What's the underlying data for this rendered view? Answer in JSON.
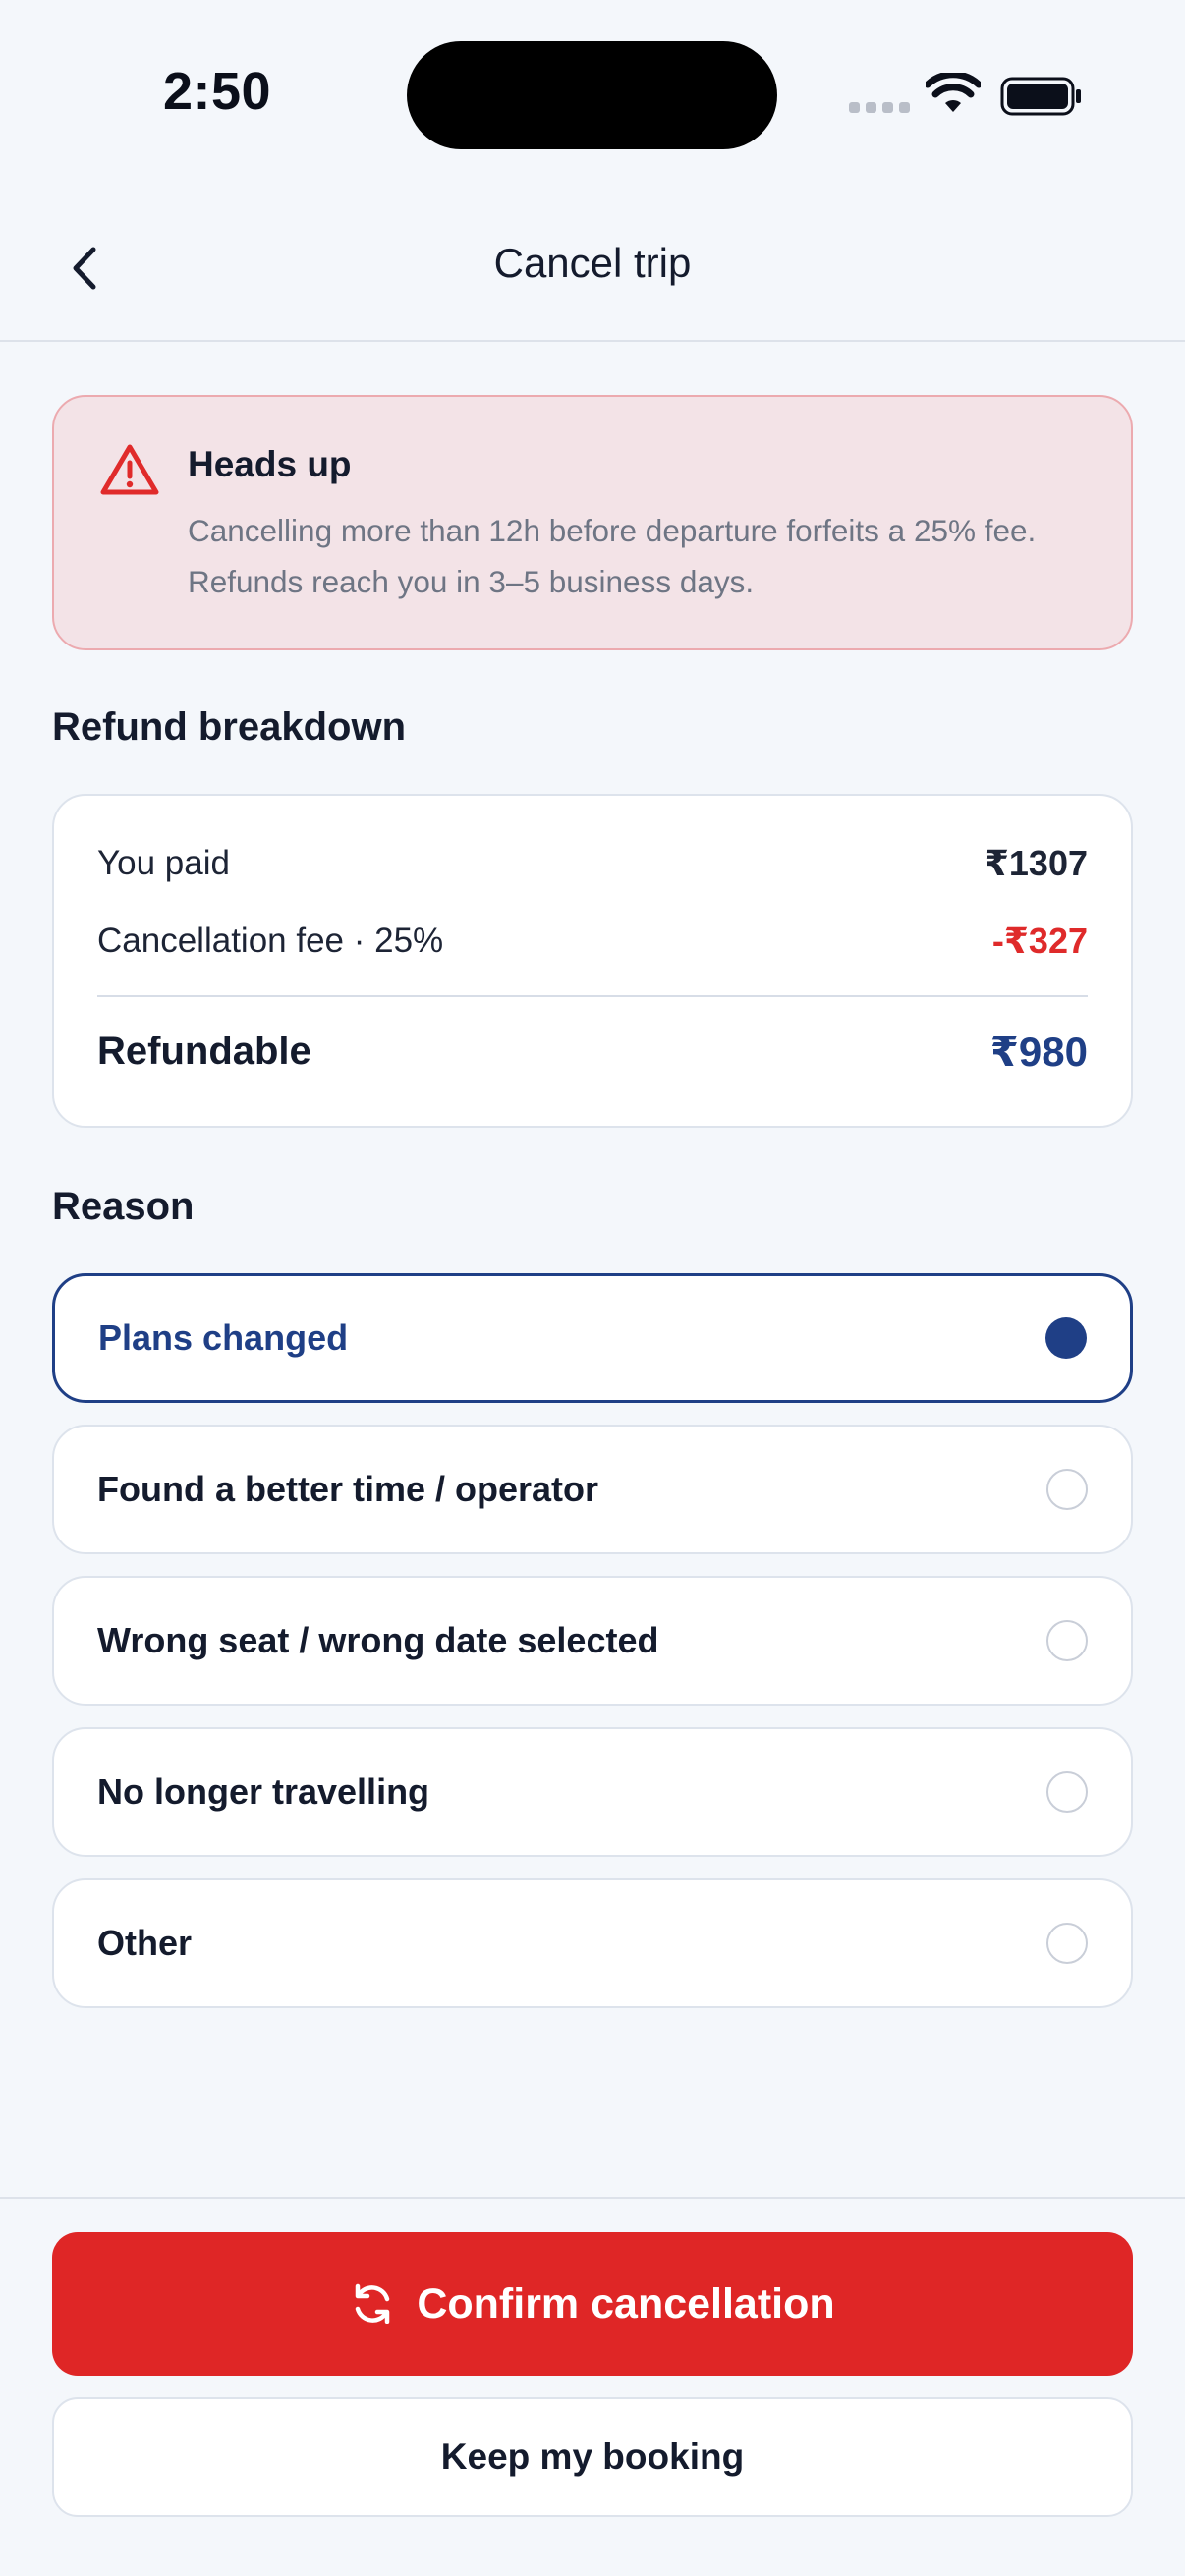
{
  "status_bar": {
    "time": "2:50",
    "icons": [
      "signal-icon",
      "wifi-icon",
      "battery-icon"
    ]
  },
  "nav": {
    "back_icon": "chevron-left-icon",
    "title": "Cancel trip"
  },
  "alert": {
    "icon": "warning-triangle-icon",
    "title": "Heads up",
    "body": "Cancelling more than 12h before departure forfeits a 25% fee. Refunds reach you in 3–5 business days."
  },
  "breakdown": {
    "section_title": "Refund breakdown",
    "rows": [
      {
        "label": "You paid",
        "value": "₹1307"
      },
      {
        "label": "Cancellation fee · 25%",
        "value": "-₹327"
      }
    ],
    "total": {
      "label": "Refundable",
      "value": "₹980"
    }
  },
  "reason": {
    "section_title": "Reason",
    "options": [
      {
        "label": "Plans changed",
        "selected": true
      },
      {
        "label": "Found a better time / operator",
        "selected": false
      },
      {
        "label": "Wrong seat / wrong date selected",
        "selected": false
      },
      {
        "label": "No longer travelling",
        "selected": false
      },
      {
        "label": "Other",
        "selected": false
      }
    ]
  },
  "actions": {
    "confirm_icon": "refresh-icon",
    "confirm_label": "Confirm cancellation",
    "keep_label": "Keep my booking"
  },
  "colors": {
    "accent": "#1f3f86",
    "danger": "#df2626",
    "alert_bg": "#f3e3e7",
    "background": "#f4f7fb"
  }
}
